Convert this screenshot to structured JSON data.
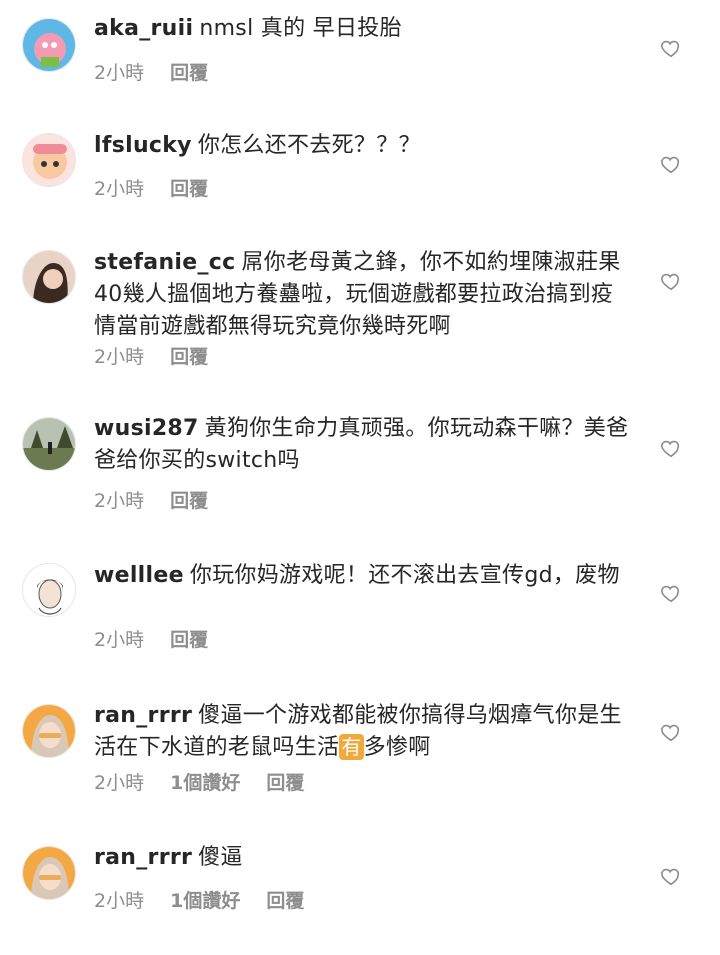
{
  "comments": [
    {
      "user": "aka_ruii",
      "text": "nmsl 真的 早日投胎",
      "time": "2小時",
      "likes": "",
      "reply": "回覆",
      "avatar_color": "#f4a6b8"
    },
    {
      "user": "lfslucky",
      "text": "你怎么还不去死？？？",
      "time": "2小時",
      "likes": "",
      "reply": "回覆",
      "avatar_color": "#f7c6c0"
    },
    {
      "user": "stefanie_cc",
      "text": "屌你老母黃之鋒，你不如約埋陳淑莊果40幾人搵個地方養蠱啦，玩個遊戲都要拉政治搞到疫情當前遊戲都無得玩究竟你幾時死啊",
      "time": "2小時",
      "likes": "",
      "reply": "回覆",
      "avatar_color": "#c98f7a"
    },
    {
      "user": "wusi287",
      "text": "黃狗你生命力真顽强。你玩动森干嘛？美爸爸给你买的switch吗",
      "time": "2小時",
      "likes": "",
      "reply": "回覆",
      "avatar_color": "#7e8b72"
    },
    {
      "user": "welllee",
      "text": "你玩你妈游戏呢！还不滚出去宣传gd，废物",
      "time": "2小時",
      "likes": "",
      "reply": "回覆",
      "avatar_color": "#dcdcdc"
    },
    {
      "user": "ran_rrrr",
      "text_a": "傻逼一个游戏都能被你搞得乌烟瘴气你是生活在下水道的老鼠吗生活",
      "emoji": "有",
      "text_b": "多惨啊",
      "time": "2小時",
      "likes": "1個讚好",
      "reply": "回覆",
      "avatar_color": "#f0b34a"
    },
    {
      "user": "ran_rrrr",
      "text": "傻逼",
      "time": "2小時",
      "likes": "1個讚好",
      "reply": "回覆",
      "avatar_color": "#f0b34a"
    }
  ]
}
